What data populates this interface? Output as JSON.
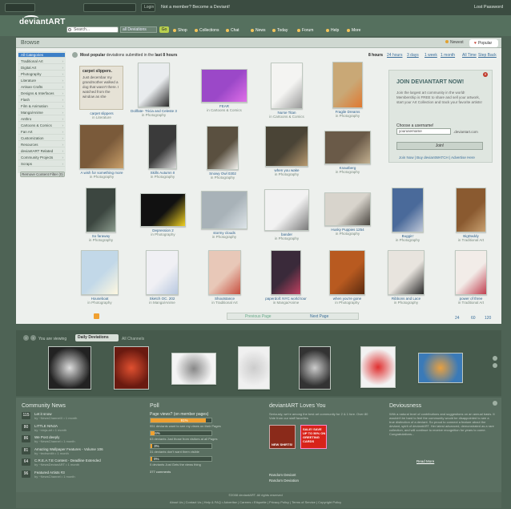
{
  "topbar": {
    "user_field": "",
    "pass_field": "",
    "login_label": "Login",
    "member_text": "Not a member? Become a Deviant!",
    "lost_pw": "Lost Password"
  },
  "header": {
    "logo": "deviantART",
    "search_placeholder": "Search...",
    "scope": "all Deviations",
    "go": "Go",
    "nav": [
      "Shop",
      "Collections",
      "Chat",
      "News",
      "Today",
      "Forum",
      "Help",
      "More"
    ]
  },
  "browse": {
    "title": "Browse",
    "tab_newest": "Newest",
    "tab_popular": "Popular"
  },
  "sidebar": {
    "items": [
      "All Categories",
      "Traditional Art",
      "Digital Art",
      "Photography",
      "Literature",
      "Artisan Crafts",
      "Designs & Interfaces",
      "Flash",
      "Film & Animation",
      "Manga/Anime",
      "Anthro",
      "Cartoons & Comics",
      "Fan Art",
      "Customization",
      "Resources",
      "deviantART Related",
      "Community Projects",
      "Scraps"
    ],
    "remove_btn": "Remove Content Filter (0)"
  },
  "popular": {
    "heading_a": "Most popular",
    "heading_b": "deviations submitted in the",
    "heading_c": "last 8 hours",
    "time_links": [
      "8 hours",
      "24 hours",
      "3 days",
      "1 week",
      "1 month",
      "All Time",
      "Step Back"
    ]
  },
  "grid": [
    {
      "title": "carpet slippers",
      "cat": "in Literature",
      "color": "#e6e2d6",
      "accent": "#cfc9b6"
    },
    {
      "title": "Dollfate- Tricia and Celeste 3",
      "cat": "in Photography",
      "color": "#e9ecee",
      "accent": "#2a2a2a"
    },
    {
      "title": "FEAR",
      "cat": "in Cartoons & Comics",
      "color": "#9b48c8",
      "accent": "#e06fe8"
    },
    {
      "title": "Nurse Titan",
      "cat": "in Cartoons & Comics",
      "color": "#f4f4f2",
      "accent": "#999"
    },
    {
      "title": "Fragile Dreams",
      "cat": "in Photography",
      "color": "#c9a876",
      "accent": "#e07830"
    },
    {
      "title": "A wish for something more",
      "cat": "in Photography",
      "color": "#7a5a3a",
      "accent": "#caa06a"
    },
    {
      "title": "Skills Autumn II",
      "cat": "in Photography",
      "color": "#3a3a3a",
      "accent": "#dcdcdc"
    },
    {
      "title": "Snowy Owl 0302",
      "cat": "in Photography",
      "color": "#5a5040",
      "accent": "#f2f2ee"
    },
    {
      "title": "when you wake",
      "cat": "in Photography",
      "color": "#4a4436",
      "accent": "#b89a70"
    },
    {
      "title": "Knautberg",
      "cat": "in Photography",
      "color": "#6a5a48",
      "accent": "#c2b090"
    },
    {
      "title": "So faraway",
      "cat": "in Photography",
      "color": "#3c4640",
      "accent": "#8a9a8c"
    },
    {
      "title": "Depression 2",
      "cat": "in Photography",
      "color": "#111",
      "accent": "#f0d020"
    },
    {
      "title": "stormy clouds",
      "cat": "in Photography",
      "color": "#a8b2b8",
      "accent": "#dde4e8"
    },
    {
      "title": "bander",
      "cat": "in Photography",
      "color": "#f2f2f2",
      "accent": "#7a7a7a"
    },
    {
      "title": "Husky Puppies 1254",
      "cat": "in Photography",
      "color": "#d8d4cc",
      "accent": "#4a4640"
    },
    {
      "title": "Buggin'",
      "cat": "in Photography",
      "color": "#4a6a9a",
      "accent": "#c0c8d8"
    },
    {
      "title": "BigDaddy",
      "cat": "in Traditional Art",
      "color": "#8a5a30",
      "accent": "#c8a070"
    },
    {
      "title": "Houseboat",
      "cat": "in Photography",
      "color": "#c2d8e8",
      "accent": "#fff8e0"
    },
    {
      "title": "Sketch OC. 202",
      "cat": "in Manga/Anime",
      "color": "#f0f0f4",
      "accent": "#b8c8e0"
    },
    {
      "title": "Shoutstance",
      "cat": "in Traditional Art",
      "color": "#e8c8b8",
      "accent": "#c85040"
    },
    {
      "title": "paperdoll: NYC world tour",
      "cat": "in Manga/Anime",
      "color": "#3a2a3a",
      "accent": "#c04060"
    },
    {
      "title": "when you're gone",
      "cat": "in Photography",
      "color": "#b85a20",
      "accent": "#5a2a10"
    },
    {
      "title": "Ribbons and Lace",
      "cat": "in Photography",
      "color": "#e8e4de",
      "accent": "#2a2a2a"
    },
    {
      "title": "power of three",
      "cat": "in Traditional Art",
      "color": "#f2ece8",
      "accent": "#c04050"
    }
  ],
  "literature_excerpt": {
    "title": "carpet slippers.",
    "body": "Just decembar my grandmother walked a dog that wasn't there. I watched from the window as she"
  },
  "join": {
    "title": "JOIN DEVIANTART NOW!",
    "text": "Join the largest art community in the world! Membership is FREE to share and sell your artwork, start your Art Collection and track your favorite artists!",
    "label": "Choose a username!",
    "input_value": "yourusername",
    "suffix": ".deviantart.com",
    "button": "Join!",
    "links": "Join Now  |  Buy deviantWATCH  |  Advertise Here"
  },
  "pager": {
    "prev": "Previous Page",
    "next": "Next Page",
    "views": [
      "24",
      "60",
      "120"
    ]
  },
  "film": {
    "viewing": "You are viewing",
    "selected": "Daily Deviations",
    "all": "All Channels",
    "thumbs": [
      {
        "color": "#222",
        "accent": "#ddd"
      },
      {
        "color": "#6a1a10",
        "accent": "#e05030"
      },
      {
        "color": "#f4f4f4",
        "accent": "#888"
      },
      {
        "color": "#f0f0f0",
        "accent": "#ccc"
      },
      {
        "color": "#333",
        "accent": "#ccc"
      },
      {
        "color": "#f2f2f2",
        "accent": "#e03030"
      },
      {
        "color": "#3a7ab8",
        "accent": "#e8a040"
      }
    ]
  },
  "community": {
    "title": "Community News",
    "items": [
      {
        "num": "115",
        "title": "Let it snow",
        "sub": "by ~NewsChannelX  • 1 month"
      },
      {
        "num": "80",
        "title": "LITTLE NINJA",
        "sub": "by ~ninja-art  • 1 month"
      },
      {
        "num": "86",
        "title": "We Post deeply",
        "sub": "by ~NewsChannel  • 1 month"
      },
      {
        "num": "81",
        "title": "Amazing Wallpaper Features - Volume 106",
        "sub": "by ~techsmith  • 1 month"
      },
      {
        "num": "64",
        "title": "C.R.E.A.T.E Contest - Deadline Extended",
        "sub": "by ~NewsDevianART  • 1 month"
      },
      {
        "num": "96",
        "title": "Featured Artists #3",
        "sub": "by ~NewsChannel  • 1 month"
      }
    ]
  },
  "poll": {
    "title": "Poll",
    "question": "Page views? (on member pages)",
    "rows": [
      {
        "pct": "91%",
        "fill": 0.91,
        "label": "951 deviants want to see my views on their Pages"
      },
      {
        "pct": "6%",
        "fill": 0.06,
        "label": "63 deviants Just those from visitors at all Pages"
      },
      {
        "pct": "3%",
        "fill": 0.03,
        "label": "31 deviants don't want them visible"
      },
      {
        "pct": "0%",
        "fill": 0.0,
        "label": "0 deviants Just Gets the views thing"
      }
    ],
    "comments": "377 comments"
  },
  "loves": {
    "title": "deviantART Loves You",
    "text": "Seriously, we're among the best art community for 2 & 1 fore. Over 80 Vote from our staff favorites",
    "ad1": "NEW SHIRTS!",
    "ad2": "SALE! SAVE UP TO 50% ON GREETING CARDS",
    "rand1": "Random Deviant",
    "rand2": "Random Deviation"
  },
  "deviousness": {
    "title": "Deviousness",
    "text": "With a natural level of contributions and suggestions on an annual basis. It wouldn't be hard to feel the community would be disappointed to see a true distinction of a deviant. So proud to connect a feature about the deviant, spirit of deviantART. Her latest advanced, demonstrated as a rare collection, and will continue to receive recognition for years to come. Congratulations...",
    "read_more": "Read More"
  },
  "footer": {
    "copyright": "©2008 deviantART. All rights reserved",
    "links": "About Us  |  Contact Us  |  Help & FAQ  •  Advertise  |  Careers  •  Etiquette  |  Privacy Policy  |  Terms of Service  |  Copyright Policy"
  }
}
